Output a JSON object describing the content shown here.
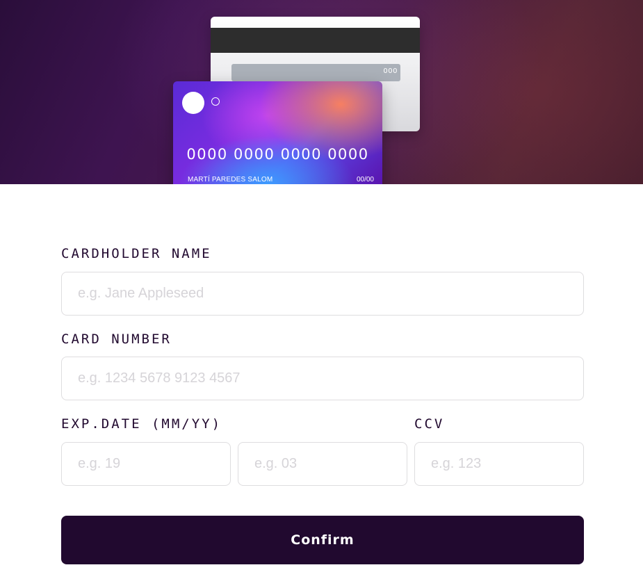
{
  "card_preview": {
    "back": {
      "cvc": "000"
    },
    "front": {
      "number": "0000 0000 0000 0000",
      "holder": "MARTÍ PAREDES SALOM",
      "expiry": "00/00"
    }
  },
  "form": {
    "cardholder_label": "CARDHOLDER NAME",
    "cardholder_placeholder": "e.g. Jane Appleseed",
    "number_label": "CARD NUMBER",
    "number_placeholder": "e.g. 1234 5678 9123 4567",
    "exp_label": "EXP.DATE (MM/YY)",
    "month_placeholder": "e.g. 19",
    "year_placeholder": "e.g. 03",
    "cvc_label": "CCV",
    "cvc_placeholder": "e.g. 123",
    "confirm_label": "Confirm"
  },
  "colors": {
    "dark_violet": "#21092f",
    "input_border": "#dedddf",
    "placeholder": "#d6d4d8"
  }
}
